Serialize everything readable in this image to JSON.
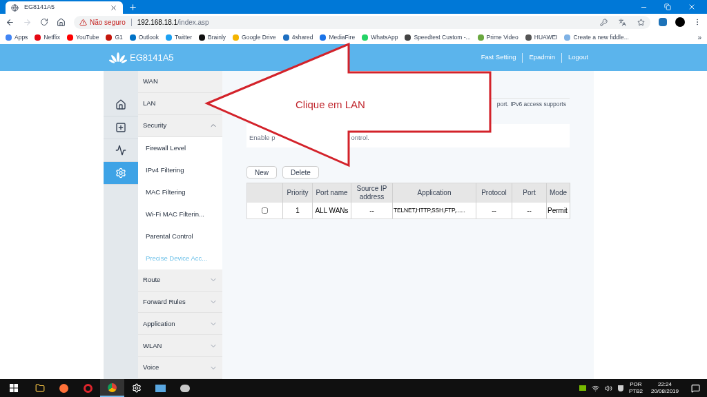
{
  "browser": {
    "tab_title": "EG8141A5",
    "url_warning": "Não seguro",
    "url_host": "192.168.18.1",
    "url_path": "/index.asp",
    "bookmarks": [
      {
        "label": "Apps",
        "color": "#4285f4"
      },
      {
        "label": "Netflix",
        "color": "#e50914"
      },
      {
        "label": "YouTube",
        "color": "#ff0000"
      },
      {
        "label": "G1",
        "color": "#c4170c"
      },
      {
        "label": "Outlook",
        "color": "#0072c6"
      },
      {
        "label": "Twitter",
        "color": "#1da1f2"
      },
      {
        "label": "Brainly",
        "color": "#111111"
      },
      {
        "label": "Google Drive",
        "color": "#f4b400"
      },
      {
        "label": "4shared",
        "color": "#1e6fc1"
      },
      {
        "label": "MediaFire",
        "color": "#1a73e8"
      },
      {
        "label": "WhatsApp",
        "color": "#25d366"
      },
      {
        "label": "Speedtest Custom -...",
        "color": "#444444"
      },
      {
        "label": "Prime Video",
        "color": "#6aa83f"
      },
      {
        "label": "HUAWEI",
        "color": "#555555"
      },
      {
        "label": "Create a new fiddle...",
        "color": "#7fb2e5"
      }
    ],
    "overflow": "»"
  },
  "header": {
    "brand": "EG8141A5",
    "links": [
      "Fast Setting",
      "Epadmin",
      "Logout"
    ]
  },
  "side_icons": [
    {
      "kind": "home",
      "selected": false
    },
    {
      "kind": "kit",
      "selected": false
    },
    {
      "kind": "pulse",
      "selected": false
    },
    {
      "kind": "gear",
      "selected": true
    }
  ],
  "menu": [
    {
      "label": "WAN",
      "kind": "link"
    },
    {
      "label": "LAN",
      "kind": "link"
    },
    {
      "label": "Security",
      "kind": "group",
      "expanded": true,
      "children": [
        {
          "label": "Firewall Level",
          "selected": false
        },
        {
          "label": "IPv4 Filtering",
          "selected": false
        },
        {
          "label": "MAC Filtering",
          "selected": false
        },
        {
          "label": "Wi-Fi MAC Filterin...",
          "selected": false
        },
        {
          "label": "Parental Control",
          "selected": false
        },
        {
          "label": "Precise Device Acc...",
          "selected": true
        }
      ]
    },
    {
      "label": "Route",
      "kind": "group",
      "expanded": false
    },
    {
      "label": "Forward Rules",
      "kind": "group",
      "expanded": false
    },
    {
      "label": "Application",
      "kind": "group",
      "expanded": false
    },
    {
      "label": "WLAN",
      "kind": "group",
      "expanded": false
    },
    {
      "label": "Voice",
      "kind": "group",
      "expanded": false
    }
  ],
  "content": {
    "description_fragment": "port. IPv6 access supports",
    "enable_fragments": [
      "Enable p",
      "ontrol."
    ],
    "buttons": [
      "New",
      "Delete"
    ],
    "table": {
      "columns": [
        "Priority",
        "Port name",
        "Source IP address",
        "Application",
        "Protocol",
        "Port",
        "Mode"
      ],
      "rows": [
        {
          "checked": false,
          "cells": [
            "1",
            "ALL WANs",
            "--",
            "TELNET,HTTP,SSH,FTP,......",
            "--",
            "--",
            "Permit"
          ]
        }
      ]
    }
  },
  "annotation": {
    "text": "Clique em LAN"
  },
  "taskbar": {
    "language": "POR",
    "layout": "PTB2",
    "time": "22:24",
    "date": "20/08/2019"
  }
}
